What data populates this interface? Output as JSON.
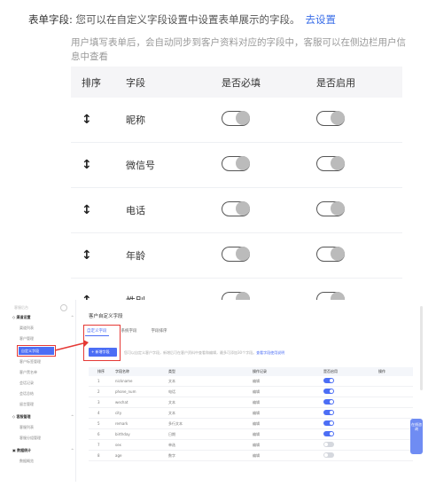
{
  "form": {
    "label": "表单字段:",
    "description": "您可以在自定义字段设置中设置表单展示的字段。",
    "link": "去设置",
    "subdesc": "用户填写表单后，会自动同步到客户资料对应的字段中，客服可以在侧边栏用户信息中查看",
    "columns": [
      "排序",
      "字段",
      "是否必填",
      "是否启用"
    ],
    "rows": [
      {
        "sort_icon": "↕",
        "field": "昵称",
        "required": false,
        "enabled": false
      },
      {
        "sort_icon": "↕",
        "field": "微信号",
        "required": false,
        "enabled": false
      },
      {
        "sort_icon": "↕",
        "field": "电话",
        "required": false,
        "enabled": false
      },
      {
        "sort_icon": "↕",
        "field": "年龄",
        "required": false,
        "enabled": false
      },
      {
        "sort_icon": "↕",
        "field": "性别",
        "required": false,
        "enabled": false
      }
    ]
  },
  "admin": {
    "sidebar": {
      "top_label": "客服后台",
      "items": [
        {
          "label": "◇ 渠道设置",
          "type": "group",
          "arrow": "^"
        },
        {
          "label": "渠道列表",
          "type": "sub"
        },
        {
          "label": "客户管理",
          "type": "sub"
        },
        {
          "label": "自定义字段",
          "type": "active"
        },
        {
          "label": "客户标签管理",
          "type": "sub"
        },
        {
          "label": "客户黑名单",
          "type": "sub"
        },
        {
          "label": "会话记录",
          "type": "sub"
        },
        {
          "label": "会话总结",
          "type": "sub"
        },
        {
          "label": "留言管理",
          "type": "sub"
        },
        {
          "label": "◇ 客服管理",
          "type": "group",
          "arrow": "^"
        },
        {
          "label": "客服列表",
          "type": "sub"
        },
        {
          "label": "客服分组管理",
          "type": "sub"
        },
        {
          "label": "▣ 数据统计",
          "type": "group",
          "arrow": "^"
        },
        {
          "label": "数据概览",
          "type": "sub"
        }
      ]
    },
    "title": "客户自定义字段",
    "tabs": [
      "自定义字段",
      "系统字段",
      "字段排序"
    ],
    "add_button": "+ 新增字段",
    "hint": "您可以自定义客户字段，新增后可在客户资料中查看和编辑，最多可添加30个字段。",
    "hint_link": "查看字段使用说明",
    "table": {
      "columns": [
        "排序",
        "字段名称",
        "类型",
        "操作记录",
        "是否启用",
        "操作"
      ],
      "rows": [
        {
          "sort": "1",
          "name": "nickname",
          "type": "文本",
          "op": "编辑",
          "enabled": true
        },
        {
          "sort": "2",
          "name": "phone_num",
          "type": "电话",
          "op": "编辑",
          "enabled": true
        },
        {
          "sort": "3",
          "name": "wechat",
          "type": "文本",
          "op": "编辑",
          "enabled": true
        },
        {
          "sort": "4",
          "name": "city",
          "type": "文本",
          "op": "编辑",
          "enabled": true
        },
        {
          "sort": "5",
          "name": "remark",
          "type": "多行文本",
          "op": "编辑",
          "enabled": true
        },
        {
          "sort": "6",
          "name": "birthday",
          "type": "日期",
          "op": "编辑",
          "enabled": true
        },
        {
          "sort": "7",
          "name": "sex",
          "type": "单选",
          "op": "编辑",
          "enabled": false
        },
        {
          "sort": "8",
          "name": "age",
          "type": "数字",
          "op": "编辑",
          "enabled": false
        }
      ]
    },
    "float_widget": "在线咨询"
  }
}
